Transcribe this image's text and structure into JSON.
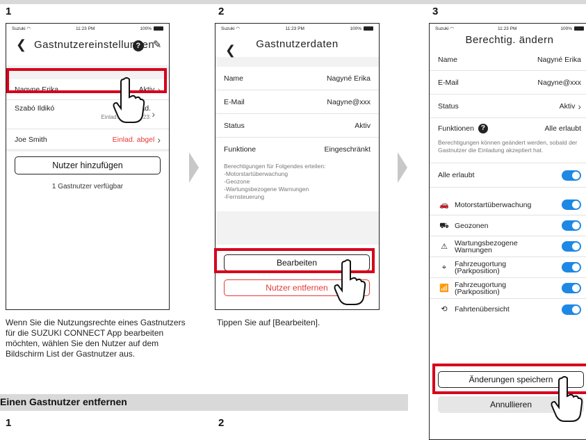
{
  "steps": {
    "s1": "1",
    "s2": "2",
    "s3": "3",
    "b1": "1",
    "b2": "2"
  },
  "status_bar": {
    "carrier": "Suzuki",
    "time": "11:23 PM",
    "battery": "100%"
  },
  "screen1": {
    "title": "Gastnutzereinstellungen",
    "users": [
      {
        "name": "Nagyne Erika",
        "status": "Aktiv"
      },
      {
        "name": "Szabó Ildikó",
        "status": "Einlad.",
        "sub": "Einlad. gültig bis 23:"
      },
      {
        "name": "Joe Smith",
        "status": "Einlad. abgel"
      }
    ],
    "add_button": "Nutzer hinzufügen",
    "available": "1 Gastnutzer verfügbar"
  },
  "screen2": {
    "title": "Gastnutzerdaten",
    "fields": [
      {
        "label": "Name",
        "value": "Nagyné Erika"
      },
      {
        "label": "E-Mail",
        "value": "Nagyne@xxx"
      },
      {
        "label": "Status",
        "value": "Aktiv"
      },
      {
        "label": "Funktione",
        "value": "Eingeschränkt"
      }
    ],
    "perm_text": "Berechtigungen für Folgendes erteilen:\n-Motorstartüberwachung\n-Geozone\n-Wartungsbezogene Warnungen\n-Fernsteuerung",
    "edit_button": "Bearbeiten",
    "remove_button": "Nutzer entfernen"
  },
  "screen3": {
    "title": "Berechtig. ändern",
    "fields": [
      {
        "label": "Name",
        "value": "Nagyné Erika"
      },
      {
        "label": "E-Mail",
        "value": "Nagyne@xxx"
      },
      {
        "label": "Status",
        "value": "Aktiv"
      }
    ],
    "functions_label": "Funktionen",
    "functions_value": "Alle erlaubt",
    "note": "Berechtigungen können geändert werden, sobald der Gastnutzer die Einladung akzeptiert hat.",
    "all_allowed": "Alle erlaubt",
    "features": [
      {
        "label": "Motorstartüberwachung",
        "icon": "car-engine-icon"
      },
      {
        "label": "Geozonen",
        "icon": "geofence-icon"
      },
      {
        "label": "Wartungsbezogene Warnungen",
        "icon": "car-warning-icon"
      },
      {
        "label": "Fahrzeugortung (Parkposition)",
        "icon": "map-pin-icon"
      },
      {
        "label": "Fahrzeugortung (Parkposition)",
        "icon": "signal-icon"
      },
      {
        "label": "Fahrtenübersicht",
        "icon": "history-icon"
      }
    ],
    "save_button": "Änderungen speichern",
    "cancel_button": "Annullieren"
  },
  "captions": {
    "c1": "Wenn Sie die Nutzungsrechte eines Gastnutzers für die SUZUKI CONNECT App bearbeiten möchten, wählen Sie den Nutzer auf dem Bildschirm List der Gastnutzer aus.",
    "c2": "Tippen Sie auf [Bearbeiten]."
  },
  "section_title": "Einen Gastnutzer entfernen",
  "colors": {
    "accent": "#1e88e5",
    "highlight": "#d6001c",
    "danger": "#e53935"
  }
}
